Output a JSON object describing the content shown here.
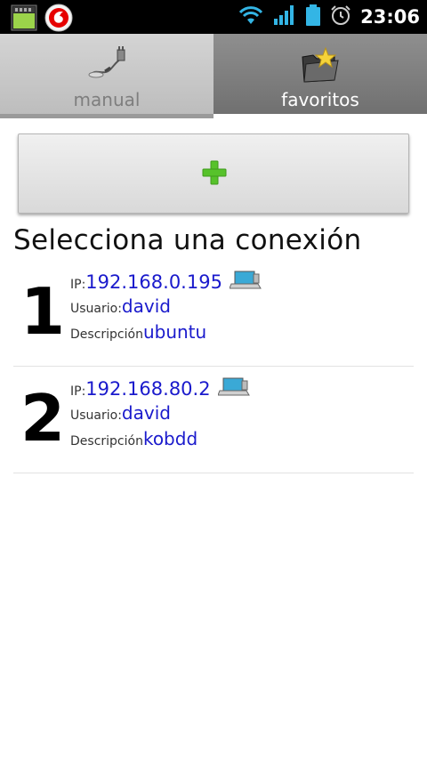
{
  "status_bar": {
    "time": "23:06",
    "icons": [
      "sd-card-icon",
      "vodafone-icon",
      "wifi-icon",
      "signal-icon",
      "battery-icon",
      "alarm-icon"
    ]
  },
  "tabs": [
    {
      "label": "manual",
      "icon": "cable-plug-icon",
      "selected": false
    },
    {
      "label": "favoritos",
      "icon": "favorite-folder-icon",
      "selected": true
    }
  ],
  "add_button": {
    "icon": "plus-icon",
    "color": "#57c22b"
  },
  "list": {
    "title": "Selecciona una conexión",
    "labels": {
      "ip": "IP:",
      "user": "Usuario:",
      "description": "Descripción"
    },
    "connections": [
      {
        "number": "1",
        "ip": "192.168.0.195",
        "user": "david",
        "description": "ubuntu",
        "icon": "computer-icon"
      },
      {
        "number": "2",
        "ip": "192.168.80.2",
        "user": "david",
        "description": "kobdd",
        "icon": "computer-icon"
      }
    ]
  },
  "colors": {
    "value_text": "#1a1acc",
    "tab_selected_bg": "#7d7d7d",
    "tab_unselected_bg": "#c8c8c8"
  }
}
